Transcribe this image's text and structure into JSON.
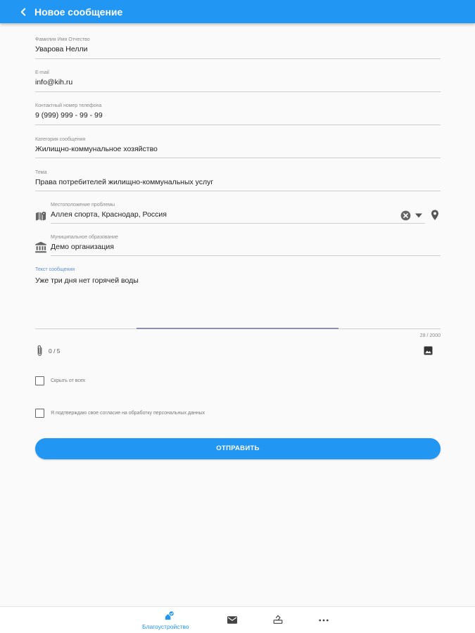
{
  "header": {
    "title": "Новое сообщение",
    "back_icon": "chevron-left-icon"
  },
  "form": {
    "fullname": {
      "label": "Фамилия Имя Отчество",
      "value": "Уварова Нелли"
    },
    "email": {
      "label": "E-mail",
      "value": "info@kih.ru"
    },
    "phone": {
      "label": "Контактный номер телефона",
      "value": "9 (999) 999 - 99 - 99"
    },
    "category": {
      "label": "Категория сообщения",
      "value": "Жилищно-коммунальное хозяйство"
    },
    "topic": {
      "label": "Тема",
      "value": "Права потребителей жилищно-коммунальных услуг"
    },
    "location": {
      "label": "Местоположение проблемы",
      "value": "Аллея спорта, Краснодар, Россия",
      "icon": "map-icon"
    },
    "municipality": {
      "label": "Муниципальное образование",
      "value": "Демо организация",
      "icon": "institution-icon"
    },
    "message": {
      "label": "Текст сообщения",
      "value": "Уже три дня нет горячей воды",
      "counter": "28 / 2000"
    },
    "attachments": {
      "count": "0 / 5",
      "icon": "paperclip-icon",
      "add_image_icon": "image-icon"
    },
    "hide_checkbox": {
      "label": "Скрыть от всех",
      "checked": false
    },
    "consent_checkbox": {
      "label": "Я подтверждаю свое согласие на обработку персональных данных",
      "checked": false
    },
    "submit_label": "ОТПРАВИТЬ"
  },
  "bottom_nav": {
    "items": [
      {
        "label": "Благоустройство",
        "icon": "improvement-icon",
        "active": true
      },
      {
        "label": "",
        "icon": "mail-icon",
        "active": false
      },
      {
        "label": "",
        "icon": "vote-icon",
        "active": false
      },
      {
        "label": "",
        "icon": "more-icon",
        "active": false
      }
    ]
  },
  "colors": {
    "primary": "#2196f3",
    "background": "#fafafa"
  }
}
